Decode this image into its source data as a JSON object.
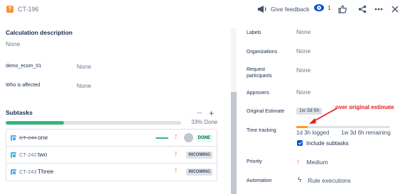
{
  "header": {
    "issue_key": "CT-196",
    "feedback_label": "Give feedback",
    "watch_count": "1"
  },
  "left": {
    "calculation": {
      "title": "Calculation description",
      "value": "None"
    },
    "demo_field": {
      "label": "demo_ecom_01",
      "value": "None"
    },
    "who_affected": {
      "label": "Who is affected",
      "value": "None"
    },
    "subtasks": {
      "title": "Subtasks",
      "more_label": "···",
      "add_label": "+",
      "progress_percent": 33,
      "progress_text": "33% Done",
      "items": [
        {
          "key": "CT-244",
          "summary": "one",
          "status": "DONE"
        },
        {
          "key": "CT-242",
          "summary": "two",
          "status": "INCOMING"
        },
        {
          "key": "CT-243",
          "summary": "Three",
          "status": "INCOMING"
        }
      ]
    }
  },
  "right": {
    "labels": {
      "label": "Labels",
      "value": "None"
    },
    "organizations": {
      "label": "Organizations",
      "value": "None"
    },
    "request_participants": {
      "label": "Request participants",
      "value": "None"
    },
    "approvers": {
      "label": "Approvers",
      "value": "None"
    },
    "original_estimate": {
      "label": "Original Estimate",
      "value": "1w 3d 6h"
    },
    "time_tracking": {
      "label": "Time tracking",
      "logged": "1d 3h logged",
      "remaining": "1w 3d 6h remaining",
      "logged_fraction": 0.12,
      "include_subtasks": "Include subtasks"
    },
    "priority": {
      "label": "Priority",
      "value": "Medium"
    },
    "automation": {
      "label": "Automation",
      "value": "Rule executions"
    }
  },
  "annotation": {
    "text": "over original estimate",
    "color": "#e31d1d"
  },
  "icons": {
    "issue_type": "question-icon",
    "feedback": "megaphone-icon",
    "watch": "eye-icon",
    "like": "thumbs-up-icon",
    "share": "share-icon",
    "more": "more-icon",
    "close": "close-icon"
  },
  "colors": {
    "accent": "#0052cc",
    "progress": "#36b37e",
    "time_logged": "#ff991f",
    "priority_medium": "#ff7452"
  }
}
